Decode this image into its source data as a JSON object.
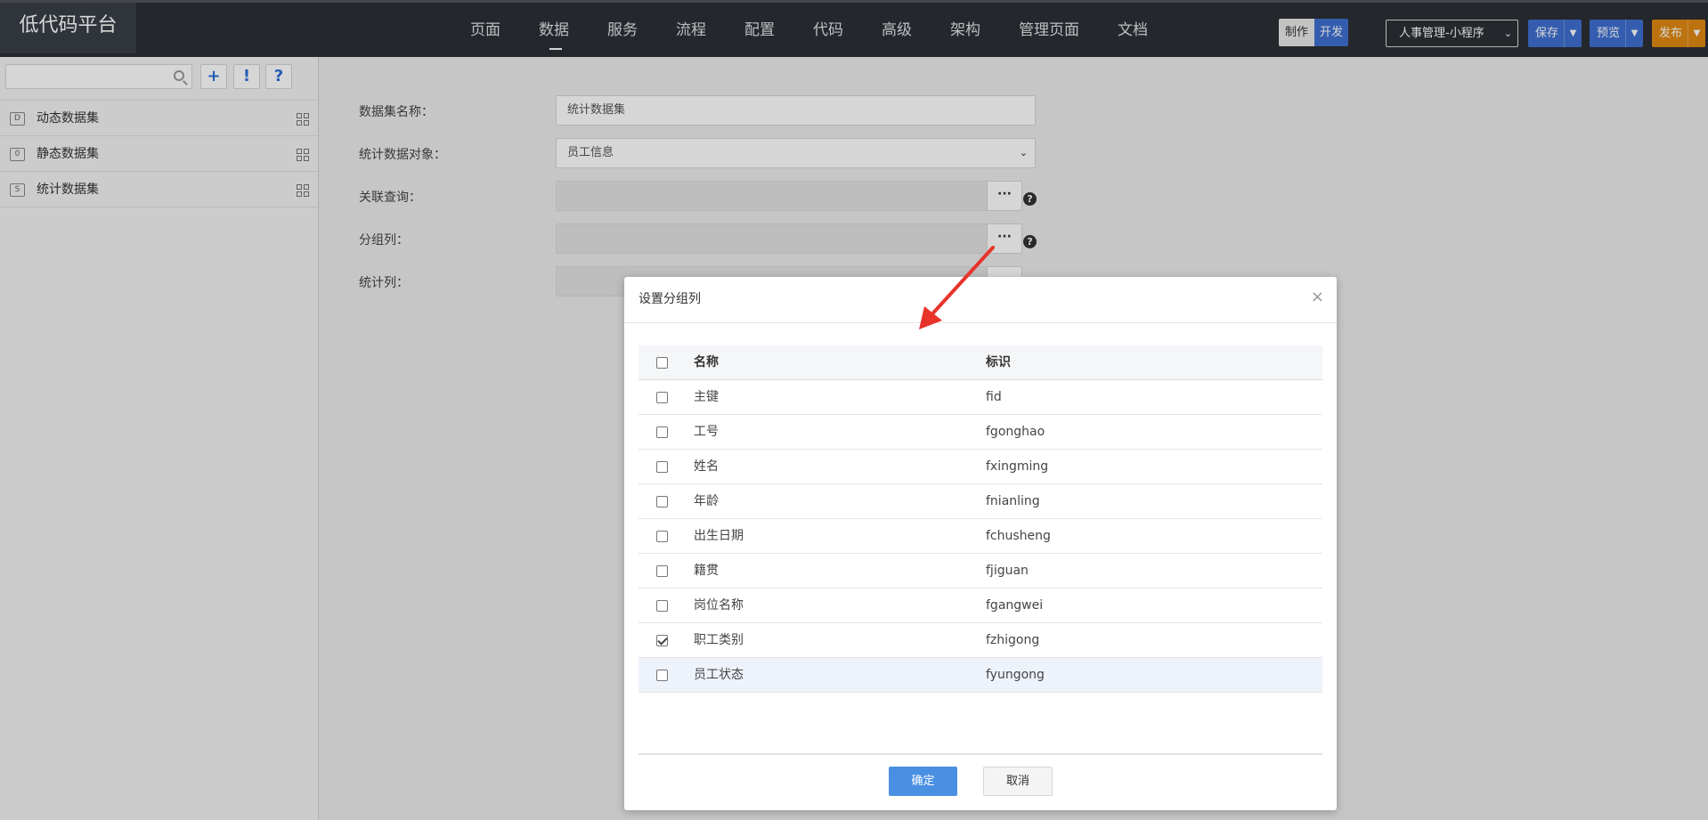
{
  "app": {
    "title": "低代码平台"
  },
  "nav": {
    "items": [
      {
        "label": "页面"
      },
      {
        "label": "数据"
      },
      {
        "label": "服务"
      },
      {
        "label": "流程"
      },
      {
        "label": "配置"
      },
      {
        "label": "代码"
      },
      {
        "label": "高级"
      },
      {
        "label": "架构"
      },
      {
        "label": "管理页面"
      },
      {
        "label": "文档"
      }
    ],
    "active": "数据"
  },
  "toolbar": {
    "mode_make": "制作",
    "mode_dev": "开发",
    "app_selector_value": "人事管理-小程序",
    "save_label": "保存",
    "preview_label": "预览",
    "publish_label": "发布",
    "accent_color": "#3f6fd1",
    "publish_color": "#e08a12"
  },
  "sidebar": {
    "search_placeholder": "",
    "tools": [
      {
        "label": "+"
      },
      {
        "label": "!"
      },
      {
        "label": "?"
      }
    ],
    "items": [
      {
        "label": "动态数据集",
        "icon_letter": "D"
      },
      {
        "label": "静态数据集",
        "icon_letter": "0"
      },
      {
        "label": "统计数据集",
        "icon_letter": "S"
      }
    ]
  },
  "form": {
    "dataset_name_label": "数据集名称：",
    "dataset_name_value": "统计数据集",
    "stat_object_label": "统计数据对象：",
    "stat_object_value": "员工信息",
    "related_query_label": "关联查询：",
    "group_cols_label": "分组列：",
    "stat_cols_label": "统计列：",
    "dots_label": "···",
    "help_label": "?"
  },
  "dialog": {
    "title": "设置分组列",
    "close_label": "×",
    "columns": {
      "name": "名称",
      "id": "标识"
    },
    "rows": [
      {
        "name": "主键",
        "id": "fid",
        "checked": false
      },
      {
        "name": "工号",
        "id": "fgonghao",
        "checked": false
      },
      {
        "name": "姓名",
        "id": "fxingming",
        "checked": false
      },
      {
        "name": "年龄",
        "id": "fnianling",
        "checked": false
      },
      {
        "name": "出生日期",
        "id": "fchusheng",
        "checked": false
      },
      {
        "name": "籍贯",
        "id": "fjiguan",
        "checked": false
      },
      {
        "name": "岗位名称",
        "id": "fgangwei",
        "checked": false
      },
      {
        "name": "职工类别",
        "id": "fzhigong",
        "checked": true
      },
      {
        "name": "员工状态",
        "id": "fyungong",
        "checked": false
      }
    ],
    "ok_label": "确定",
    "cancel_label": "取消"
  }
}
